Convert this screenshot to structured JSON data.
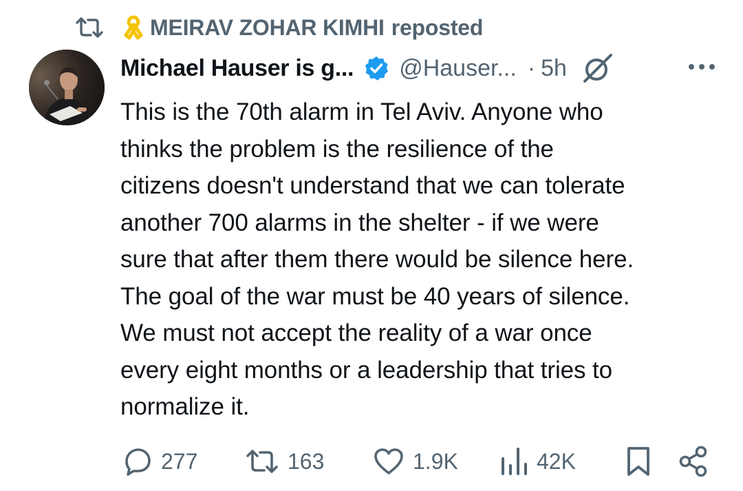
{
  "repost": {
    "reposter": "MEIRAV ZOHAR KIMHI",
    "suffix": "reposted",
    "icon": "repost-icon",
    "badge_icon": "yellow-ribbon-icon"
  },
  "post": {
    "author_name": "Michael Hauser is g...",
    "verified": true,
    "handle": "@Hauser...",
    "separator": "·",
    "time": "5h",
    "text": "This is the 70th alarm in Tel Aviv. Anyone who\nthinks the problem is the resilience of the\ncitizens doesn't understand that we can tolerate\nanother 700 alarms in the shelter - if we were\nsure that after them there would be silence here.\nThe goal of the war must be 40 years of silence.\nWe must not accept the reality of a war once\nevery eight months or a leadership that tries to\nnormalize it."
  },
  "actions": {
    "replies": "277",
    "reposts": "163",
    "likes": "1.9K",
    "views": "42K"
  },
  "colors": {
    "text": "#0f1419",
    "secondary": "#536471",
    "verified_blue": "#1d9bf0",
    "ribbon": "#f5c400"
  }
}
